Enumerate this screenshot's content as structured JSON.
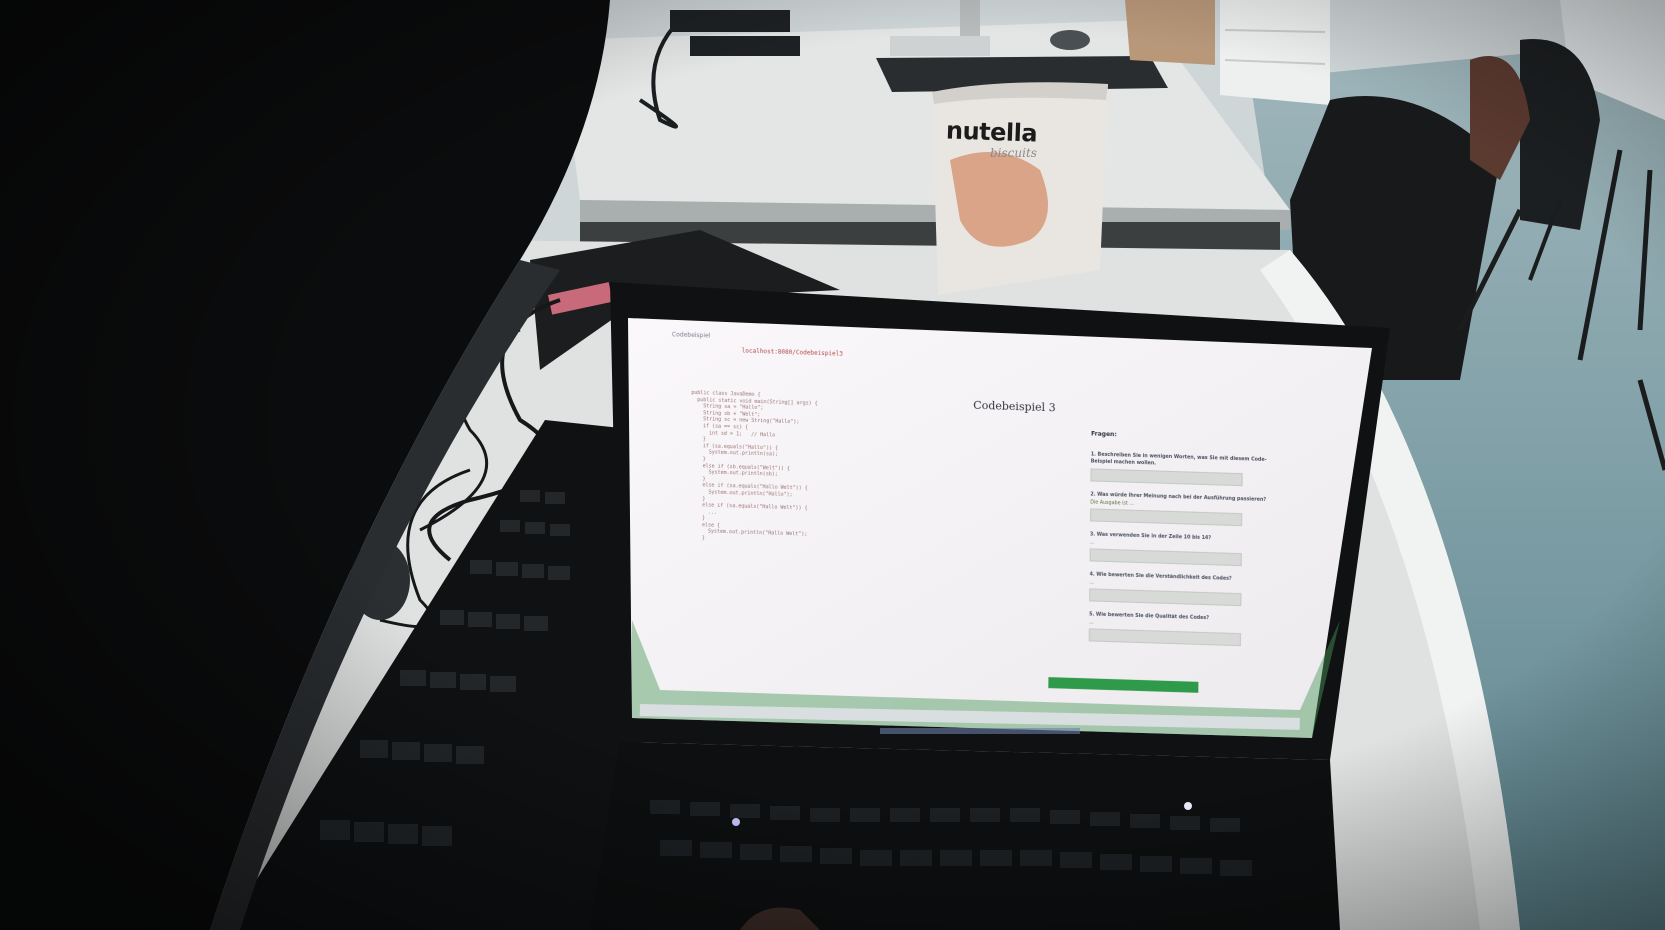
{
  "scene": {
    "description_tags": [
      "desk",
      "laptop",
      "monitor",
      "keyboard",
      "snack-bag",
      "chairs"
    ]
  },
  "snack_bag": {
    "brand": "nutella",
    "sub": "biscuits"
  },
  "laptop_screen": {
    "tab_title": "Codebeispiel",
    "url": "localhost:8080/Codebeispiel3",
    "app_title": "Codebeispiel 3",
    "code_lines": [
      "public class JavaDemo {",
      "  public static void main(String[] args) {",
      "    String sa = \"Hallo\";",
      "    String sb = \"Welt\";",
      "    String sc = new String(\"Hallo\");",
      "    if (sa == sc) {",
      "      int sd = 1;   // Hallo",
      "    }",
      "    if (sa.equals(\"Hallo\")) {",
      "      System.out.println(sa);",
      "    }",
      "    else if (sb.equals(\"Welt\")) {",
      "      System.out.println(sb);",
      "    }",
      "    else if (sa.equals(\"Hallo Welt\")) {",
      "      System.out.println(\"Hallo\");",
      "    }",
      "    else if (sa.equals(\"Hallo Welt\")) {",
      "      ...",
      "    }",
      "    else {",
      "      System.out.println(\"Hallo Welt\");",
      "    }"
    ],
    "questions_heading": "Fragen:",
    "questions": [
      {
        "text": "1. Beschreiben Sie in wenigen Worten, was Sie mit diesem Code-Beispiel machen wollen.",
        "answer": ""
      },
      {
        "text": "2. Was würde Ihrer Meinung nach bei der Ausführung passieren?",
        "answer": "Die Ausgabe ist ..."
      },
      {
        "text": "3. Was verwenden Sie in der Zeile 10 bis 14?",
        "answer": "..."
      },
      {
        "text": "4. Wie bewerten Sie die Verständlichkeit des Codes?",
        "answer": "..."
      },
      {
        "text": "5. Wie bewerten Sie die Qualität des Codes?",
        "answer": "..."
      }
    ]
  },
  "colors": {
    "wall": "#cfd6d8",
    "floor": "#6d8e96",
    "desk_surface": "#e8eae8",
    "laptop_body": "#111315",
    "laptop_screen": "#f4f1f4",
    "taskbar_green": "#2a8a3a",
    "nutella_red": "#c21b1b"
  }
}
